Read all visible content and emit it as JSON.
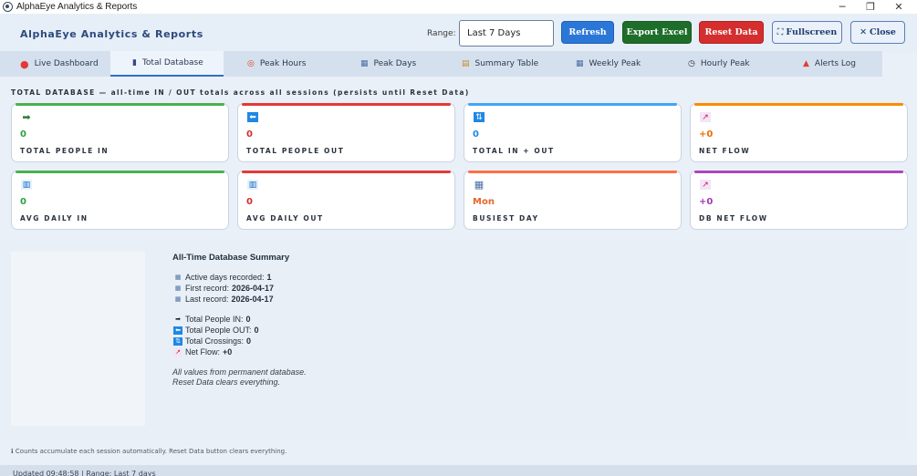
{
  "window": {
    "title": "AlphaEye Analytics & Reports",
    "controls": [
      "─",
      "❐",
      "✕"
    ]
  },
  "header": {
    "title": "AlphaEye Analytics & Reports",
    "range_label": "Range:",
    "range_value": "Last 7 Days",
    "buttons": {
      "refresh": "Refresh",
      "export": "Export Excel",
      "reset": "Reset Data",
      "fullscreen": "Fullscreen",
      "close": "Close"
    }
  },
  "tabs": [
    {
      "label": "Live Dashboard",
      "icon": "red-dot-icon"
    },
    {
      "label": "Total Database",
      "icon": "database-icon",
      "active": true
    },
    {
      "label": "Peak Hours",
      "icon": "target-icon"
    },
    {
      "label": "Peak Days",
      "icon": "calendar-icon"
    },
    {
      "label": "Summary Table",
      "icon": "table-icon"
    },
    {
      "label": "Weekly Peak",
      "icon": "calendar-icon"
    },
    {
      "label": "Hourly Peak",
      "icon": "clock-icon"
    },
    {
      "label": "Alerts Log",
      "icon": "alert-icon"
    }
  ],
  "section": {
    "title": "TOTAL DATABASE — all-time IN / OUT totals across all sessions (persists until Reset Data)"
  },
  "cards": [
    {
      "label": "TOTAL PEOPLE IN",
      "value": "0",
      "icon": "arrow-right-icon",
      "accent": "#4caf50",
      "value_color": "#2e9e44"
    },
    {
      "label": "TOTAL PEOPLE OUT",
      "value": "0",
      "icon": "arrow-left-icon",
      "accent": "#e53935",
      "value_color": "#d32f2f"
    },
    {
      "label": "TOTAL IN + OUT",
      "value": "0",
      "icon": "updown-arrows-icon",
      "accent": "#42a5f5",
      "value_color": "#1e88e5"
    },
    {
      "label": "NET FLOW",
      "value": "+0",
      "icon": "trend-chart-icon",
      "accent": "#fb8c00",
      "value_color": "#ef6c00"
    },
    {
      "label": "AVG DAILY IN",
      "value": "0",
      "icon": "bar-chart-icon",
      "accent": "#4caf50",
      "value_color": "#2e9e44"
    },
    {
      "label": "AVG DAILY OUT",
      "value": "0",
      "icon": "bar-chart-icon",
      "accent": "#e53935",
      "value_color": "#d32f2f"
    },
    {
      "label": "BUSIEST DAY",
      "value": "Mon",
      "icon": "calendar-icon",
      "accent": "#ff7043",
      "value_color": "#e8662a"
    },
    {
      "label": "DB NET FLOW",
      "value": "+0",
      "icon": "trend-chart-icon",
      "accent": "#ab47bc",
      "value_color": "#9c3cb0"
    }
  ],
  "summary": {
    "title": "All-Time Database Summary",
    "rows": [
      {
        "label": "Active days recorded:",
        "value": "1",
        "icon": "calendar-icon"
      },
      {
        "label": "First record:",
        "value": "2026-04-17",
        "icon": "calendar-icon"
      },
      {
        "label": "Last record:",
        "value": "2026-04-17",
        "icon": "calendar-icon"
      },
      {
        "label": "Total People IN:",
        "value": "0",
        "icon": "arrow-right-icon"
      },
      {
        "label": "Total People OUT:",
        "value": "0",
        "icon": "arrow-left-icon"
      },
      {
        "label": "Total Crossings:",
        "value": "0",
        "icon": "updown-arrows-icon"
      },
      {
        "label": "Net Flow:",
        "value": "+0",
        "icon": "trend-chart-icon"
      }
    ],
    "note_1": "All values from permanent database.",
    "note_2": "Reset Data clears everything."
  },
  "footer_note": "Counts accumulate each session automatically. Reset Data button clears everything.",
  "status": "Updated 09:48:58  |  Range: Last 7 days",
  "colors": {
    "brand": "#2c4a7c",
    "refresh": "#2b77d8",
    "export": "#1e6e2a",
    "reset": "#d42e2e"
  }
}
